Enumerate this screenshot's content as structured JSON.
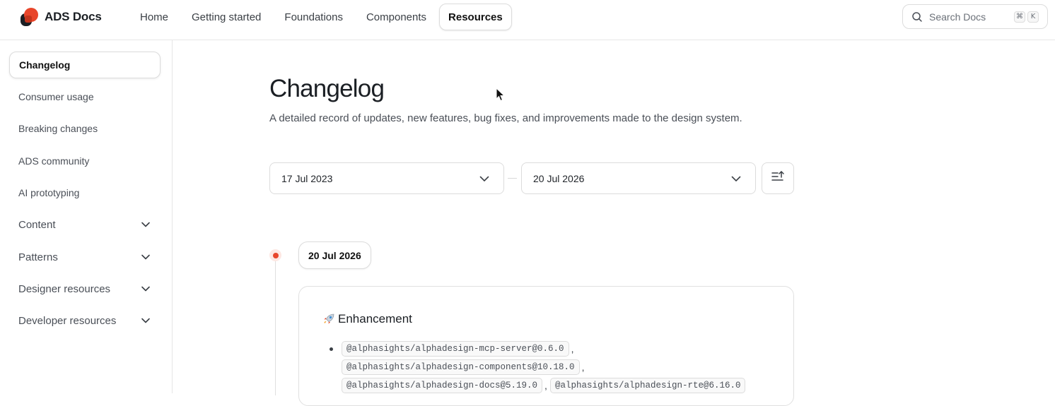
{
  "brand": {
    "name": "ADS Docs"
  },
  "nav": {
    "items": [
      {
        "label": "Home"
      },
      {
        "label": "Getting started"
      },
      {
        "label": "Foundations"
      },
      {
        "label": "Components"
      },
      {
        "label": "Resources"
      }
    ],
    "active": "Resources"
  },
  "search": {
    "placeholder": "Search Docs",
    "shortcut": [
      "⌘",
      "K"
    ]
  },
  "sidebar": {
    "items": [
      {
        "label": "Changelog",
        "active": true
      },
      {
        "label": "Consumer usage"
      },
      {
        "label": "Breaking changes"
      },
      {
        "label": "ADS community"
      },
      {
        "label": "AI prototyping"
      },
      {
        "label": "Content",
        "expandable": true
      },
      {
        "label": "Patterns",
        "expandable": true
      },
      {
        "label": "Designer resources",
        "expandable": true
      },
      {
        "label": "Developer resources",
        "expandable": true
      }
    ]
  },
  "page": {
    "title": "Changelog",
    "subtitle": "A detailed record of updates, new features, bug fixes, and improvements made to the design system."
  },
  "filters": {
    "start_date": "17 Jul 2023",
    "end_date": "20 Jul 2026"
  },
  "timeline": {
    "date": "20 Jul 2026",
    "entry": {
      "category": "Enhancement",
      "packages": [
        "@alphasights/alphadesign-mcp-server@0.6.0",
        "@alphasights/alphadesign-components@10.18.0",
        "@alphasights/alphadesign-docs@5.19.0",
        "@alphasights/alphadesign-rte@6.16.0"
      ],
      "separator": ","
    }
  },
  "colors": {
    "accent": "#e8452a",
    "border": "#dcdcdc",
    "text": "#1f2328"
  },
  "icons": {
    "logo": "ads-logo-icon",
    "search": "search-icon",
    "chevron": "chevron-down-icon",
    "sort": "sort-ascending-icon",
    "category": "rocket-icon",
    "pointer": "cursor-icon"
  }
}
